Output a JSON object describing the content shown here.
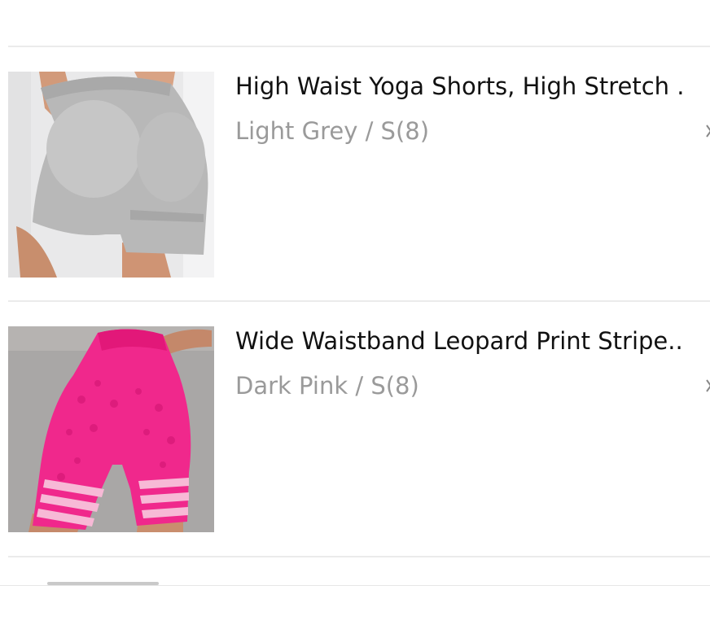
{
  "products": [
    {
      "title": "High Waist Yoga Shorts, High Stretch .",
      "variant": "Light Grey / S(8)",
      "image_icon": "grey-yoga-shorts-image",
      "color": "#b8b8b8"
    },
    {
      "title": "Wide Waistband Leopard Print Stripe..",
      "variant": "Dark Pink / S(8)",
      "image_icon": "pink-leopard-shorts-image",
      "color": "#f0288c"
    }
  ],
  "icons": {
    "chevron": "chevron-right-icon"
  },
  "colors": {
    "divider": "#ebebeb",
    "title_text": "#111111",
    "variant_text": "#9a9a9a"
  }
}
